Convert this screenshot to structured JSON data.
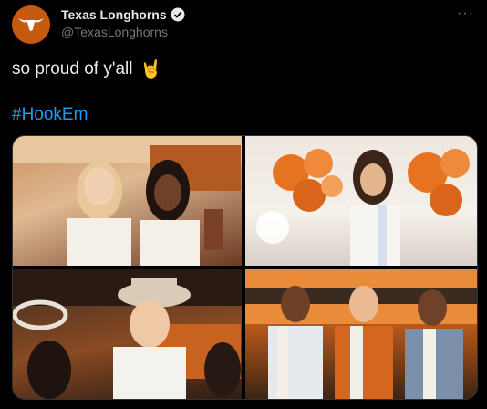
{
  "author": {
    "name": "Texas Longhorns",
    "handle": "@TexasLonghorns",
    "avatar_icon": "longhorn-logo-icon",
    "verified_icon": "verified-badge-icon",
    "avatar_color": "#c65b10"
  },
  "menu": {
    "more_icon": "more-options-icon",
    "label": "···"
  },
  "tweet": {
    "text": "so proud of y'all",
    "emoji": "🤘",
    "hashtag": "#HookEm"
  },
  "colors": {
    "background": "#000000",
    "text": "#e7e9ea",
    "secondary_text": "#71767b",
    "link": "#1d9bf0",
    "verified": "#e7e9ea"
  }
}
